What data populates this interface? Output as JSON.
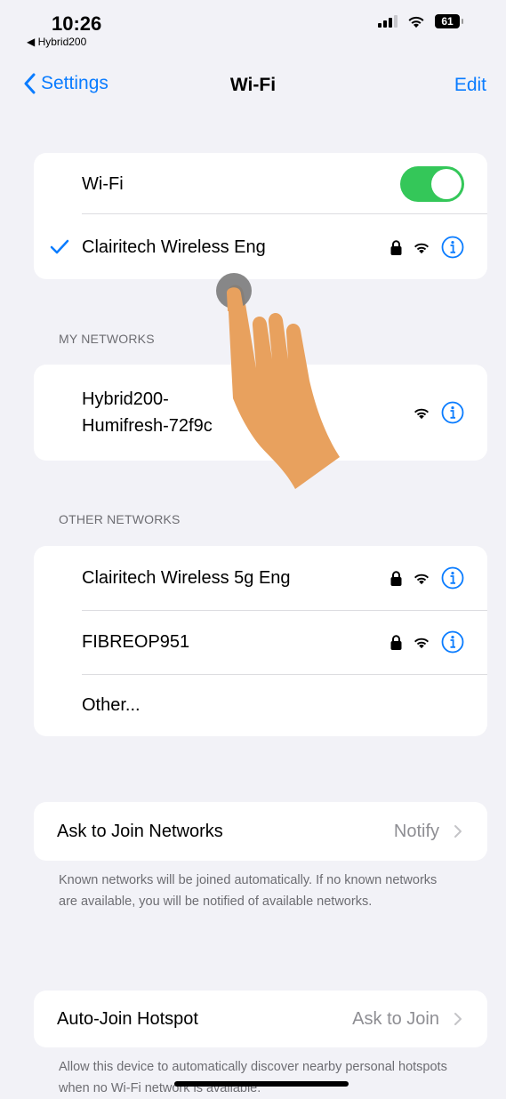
{
  "status_bar": {
    "time": "10:26",
    "back_app": "◀ Hybrid200",
    "battery": "61"
  },
  "nav": {
    "back_label": "Settings",
    "title": "Wi-Fi",
    "edit_label": "Edit"
  },
  "wifi_card": {
    "toggle_label": "Wi-Fi",
    "toggle_on": true,
    "connected_network": "Clairitech Wireless Eng"
  },
  "my_networks": {
    "header": "MY NETWORKS",
    "items": [
      {
        "name_line1": "Hybrid200-",
        "name_line2": "Humifresh-72f9c",
        "locked": false
      }
    ]
  },
  "other_networks": {
    "header": "OTHER NETWORKS",
    "items": [
      {
        "name": "Clairitech Wireless 5g Eng",
        "locked": true
      },
      {
        "name": "FIBREOP951",
        "locked": true
      }
    ],
    "other_label": "Other..."
  },
  "ask_to_join": {
    "label": "Ask to Join Networks",
    "value": "Notify",
    "footnote": "Known networks will be joined automatically. If no known networks are available, you will be notified of available networks."
  },
  "auto_join": {
    "label": "Auto-Join Hotspot",
    "value": "Ask to Join",
    "footnote": "Allow this device to automatically discover nearby personal hotspots when no Wi-Fi network is available."
  },
  "colors": {
    "accent": "#0a7cff",
    "toggle_on": "#34c759",
    "background": "#f2f2f7",
    "hand": "#e8a15e"
  }
}
